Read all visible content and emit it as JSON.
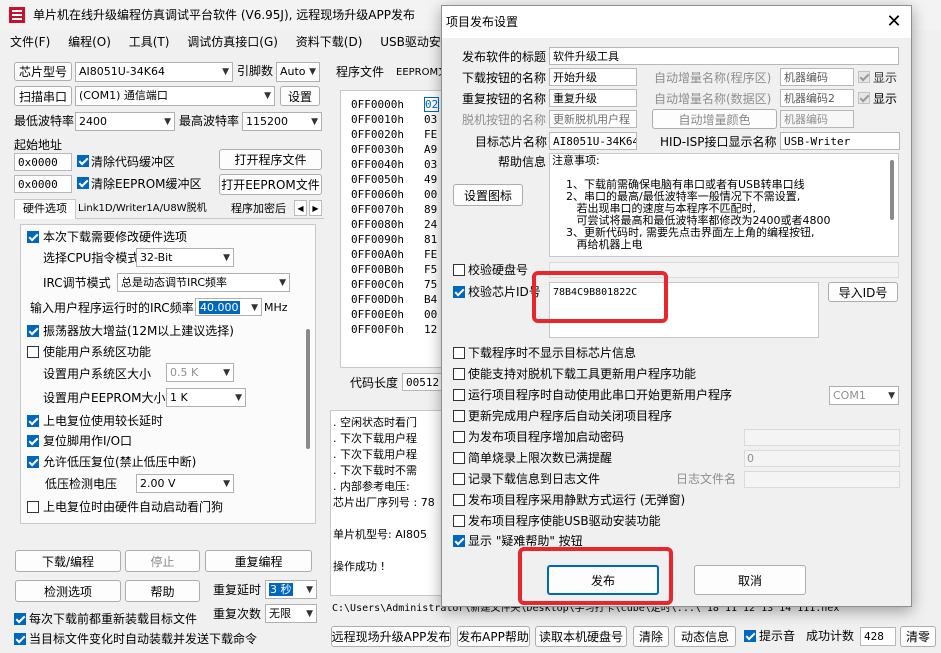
{
  "app": {
    "title": "单片机在线升级编程仿真调试平台软件 (V6.95J), 远程现场升级APP发布",
    "menu": [
      "文件(F)",
      "编程(O)",
      "工具(T)",
      "调试仿真接口(G)",
      "资料下载(D)",
      "USB驱动安装(D"
    ],
    "chip_label": "芯片型号",
    "chip_value": "AI8051U-34K64",
    "pin_label": "引脚数",
    "pin_value": "Auto",
    "scan_btn": "扫描串口",
    "port_value": "(COM1) 通信端口",
    "settings_btn": "设置",
    "min_baud_label": "最低波特率",
    "min_baud_value": "2400",
    "max_baud_label": "最高波特率",
    "max_baud_value": "115200",
    "start_addr_label": "起始地址",
    "addr1": "0x0000",
    "clear_code": "清除代码缓冲区",
    "open_prog_btn": "打开程序文件",
    "addr2": "0x0000",
    "clear_eeprom": "清除EEPROM缓冲区",
    "open_eeprom_btn": "打开EEPROM文件",
    "tabs": [
      "硬件选项",
      "Link1D/Writer1A/U8W脱机",
      "程序加密后"
    ],
    "hw": {
      "modify": "本次下载需要修改硬件选项",
      "cpu_label": "选择CPU指令模式",
      "cpu_value": "32-Bit",
      "irc_label": "IRC调节模式",
      "irc_value": "总是动态调节IRC频率",
      "freq_label": "输入用户程序运行时的IRC频率",
      "freq_value": "40.000",
      "freq_unit": "MHz",
      "amp": "振荡器放大增益(12M以上建议选择)",
      "user_sys": "使能用户系统区功能",
      "sys_size_label": "设置用户系统区大小",
      "sys_size_value": "0.5 K",
      "eeprom_label": "设置用户EEPROM大小",
      "eeprom_value": "1   K",
      "long_delay": "上电复位使用较长延时",
      "reset_io": "复位脚用作I/O口",
      "low_volt": "允许低压复位(禁止低压中断)",
      "low_volt_label": "低压检测电压",
      "low_volt_value": "2.00 V",
      "wdt": "上电复位时由硬件自动启动看门狗"
    },
    "download_btn": "下载/编程",
    "stop_btn": "停止",
    "reprog_btn": "重复编程",
    "detect_btn": "检测选项",
    "help_btn": "帮助",
    "repeat_delay_label": "重复延时",
    "repeat_delay_value": "3 秒",
    "repeat_count_label": "重复次数",
    "repeat_count_value": "无限",
    "reload_before": "每次下载前都重新装载目标文件",
    "auto_send": "当目标文件变化时自动装载并发送下载命令",
    "code_tabs": [
      "程序文件",
      "EEPROM文"
    ],
    "code_rows": [
      {
        "addr": "0FF0000h",
        "val": "02"
      },
      {
        "addr": "0FF0010h",
        "val": "03"
      },
      {
        "addr": "0FF0020h",
        "val": "FE"
      },
      {
        "addr": "0FF0030h",
        "val": "A9"
      },
      {
        "addr": "0FF0040h",
        "val": "03"
      },
      {
        "addr": "0FF0050h",
        "val": "49"
      },
      {
        "addr": "0FF0060h",
        "val": "00"
      },
      {
        "addr": "0FF0070h",
        "val": "89"
      },
      {
        "addr": "0FF0080h",
        "val": "24"
      },
      {
        "addr": "0FF0090h",
        "val": "81"
      },
      {
        "addr": "0FF00A0h",
        "val": "FE"
      },
      {
        "addr": "0FF00B0h",
        "val": "F5"
      },
      {
        "addr": "0FF00C0h",
        "val": "75"
      },
      {
        "addr": "0FF00D0h",
        "val": "B4"
      },
      {
        "addr": "0FF00E0h",
        "val": "00"
      },
      {
        "addr": "0FF00F0h",
        "val": "12"
      }
    ],
    "code_len_label": "代码长度",
    "code_len_value": "00512",
    "log_lines": [
      ". 空闲状态时看门",
      ". 下次下载用户程",
      ". 下次下载用户程",
      ". 下次下载时不需",
      ". 内部参考电压:",
      "芯片出厂序列号 : 78",
      "",
      "  单片机型号: AI805",
      "",
      "操作成功 !"
    ],
    "path": "C:\\Users\\Administrator\\新建文件夹\\Desktop\\学习打卡\\cube\\定时\\...\\ 18 11 12 13 14 111.hex",
    "bottom": {
      "publish_app": "远程现场升级APP发布",
      "app_help": "发布APP帮助",
      "read_disk": "读取本机硬盘号",
      "clear": "清除",
      "dyn_info": "动态信息",
      "beep": "提示音",
      "success_label": "成功计数",
      "success_value": "428",
      "clear2": "清零"
    }
  },
  "dialog": {
    "title": "项目发布设置",
    "pub_title_label": "发布软件的标题",
    "pub_title_value": "软件升级工具",
    "dl_btn_label": "下载按钮的名称",
    "dl_btn_value": "开始升级",
    "re_btn_label": "重复按钮的名称",
    "re_btn_value": "重复升级",
    "offline_label": "脱机按钮的名称",
    "offline_value": "更新脱机用户程",
    "auto_prog_label": "自动增量名称(程序区)",
    "auto_prog_value": "机器编码",
    "auto_data_label": "自动增量名称(数据区)",
    "auto_data_value": "机器编码2",
    "auto_color_btn": "自动增量颜色",
    "auto_color_value": "机器编码",
    "show1": "显示",
    "show2": "显示",
    "target_label": "目标芯片名称",
    "target_value": "AI8051U-34K64",
    "hid_label": "HID-ISP接口显示名称",
    "hid_value": "USB-Writer",
    "help_label": "帮助信息",
    "set_icon_btn": "设置图标",
    "help_text": [
      "注意事项:",
      "",
      "    1、下载前需确保电脑有串口或者有USB转串口线",
      "    2、串口的最高/最低波特率一般情况下不需设置,",
      "       若出现串口的速度与本程序不匹配时,",
      "       可尝试将最高和最低波特率都修改为2400或者4800",
      "    3、更新代码时, 需要先点击界面左上角的编程按钮,",
      "       再给机器上电"
    ],
    "check_disk": "校验硬盘号",
    "check_chip": "校验芯片ID号",
    "chip_id": "78B4C9B801822C",
    "import_id_btn": "导入ID号",
    "options": [
      {
        "label": "下载程序时不显示目标芯片信息",
        "on": false
      },
      {
        "label": "使能支持对脱机下载工具更新用户程序功能",
        "on": false
      },
      {
        "label": "运行项目程序时自动使用此串口开始更新用户程序",
        "on": false
      },
      {
        "label": "更新完成用户程序后自动关闭项目程序",
        "on": false
      },
      {
        "label": "为发布项目程序增加启动密码",
        "on": false
      },
      {
        "label": "简单烧录上限次数已满提醒",
        "on": false
      },
      {
        "label": "记录下载信息到日志文件",
        "on": false
      },
      {
        "label": "发布项目程序采用静默方式运行 (无弹窗)",
        "on": false
      },
      {
        "label": "发布项目程序使能USB驱动安装功能",
        "on": false
      },
      {
        "label": "显示 \"疑难帮助\" 按钮",
        "on": true
      }
    ],
    "com_value": "COM1",
    "limit_value": "0",
    "log_name_label": "日志文件名",
    "publish_btn": "发布",
    "cancel_btn": "取消",
    "colors": {
      "highlight": "#e8262b",
      "accent": "#0067c0"
    }
  }
}
